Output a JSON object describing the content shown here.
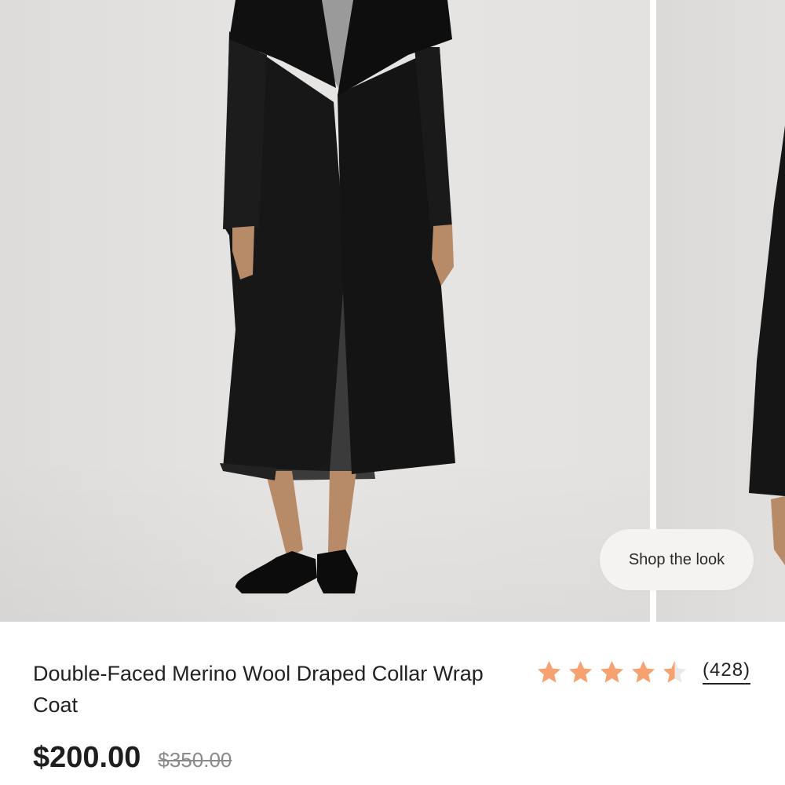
{
  "gallery": {
    "shop_the_look_label": "Shop the look",
    "coat_color": "#141414",
    "skirt_color": "#3a3a3a",
    "background_color": "#e4e2e0"
  },
  "product": {
    "title": "Double-Faced Merino Wool Draped Collar Wrap Coat",
    "rating": 4.5,
    "rating_max": 5,
    "star_color": "#f6a170",
    "review_count": "(428)",
    "price": "$200.00",
    "original_price": "$350.00"
  }
}
